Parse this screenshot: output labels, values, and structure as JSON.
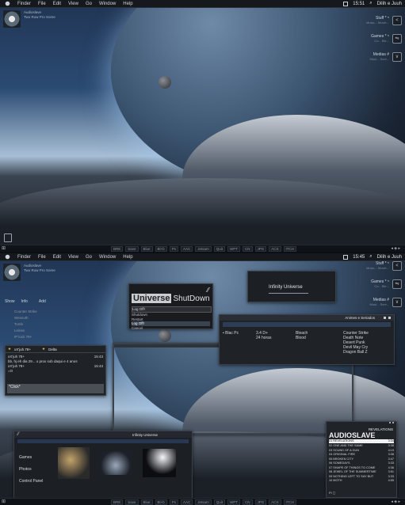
{
  "menubar": {
    "items": [
      "Finder",
      "File",
      "Edit",
      "View",
      "Go",
      "Window",
      "Help"
    ],
    "time_top": "15:51",
    "time_bottom": "15:45",
    "user": "Dilih e Juuh"
  },
  "itunes": {
    "title": "Audioslave",
    "subtitle": "Two Row Pro Some"
  },
  "dock_right": [
    {
      "label": "Stuff * ⁵",
      "sub": "Music... Movie...",
      "icon": "<"
    },
    {
      "label": "Games * ⁵",
      "sub": "Co... Ble...",
      "icon": "⇋"
    },
    {
      "label": "Medias #",
      "sub": "Musi... Scre...",
      "icon": "∨"
    }
  ],
  "taskbar": {
    "items": [
      "BRE",
      "Save",
      "Blue",
      "Bl+b",
      "Ps",
      "AAC",
      "Jetsam",
      "Quit",
      "WPT",
      "CN",
      "JPG",
      "ACS",
      "ITCH"
    ]
  },
  "shutdown": {
    "brand": "Universe",
    "title": "ShutDown",
    "selected": "Log Off!",
    "options": [
      "Shutdown",
      "Restart",
      "Log Off!",
      "Cancel"
    ]
  },
  "infinity_top": {
    "label": "Infinity Universe"
  },
  "left_links": {
    "tabs": [
      "Show",
      "Info",
      "Add"
    ],
    "items": [
      "Counter Strike",
      "Wesnoth",
      "Tomb",
      "Leinex",
      "IP lock 78+"
    ]
  },
  "chat": {
    "header_left": "xX'juh.78+",
    "header_right": "Delta",
    "lines": [
      {
        "who": "xX'juh 78+",
        "time": "15:43"
      },
      {
        "who": "bb, hj eh dia 29... o prox sob daqui e 4 anos",
        "time": ""
      },
      {
        "who": "xX'juh 78+",
        "time": "15:43"
      },
      {
        "who": "=O",
        "time": ""
      }
    ],
    "input": "*Click*"
  },
  "games": {
    "title": "Animes e Seriados",
    "left_label": "Blac Pc",
    "col1": [
      "3.4 D+",
      "24 horas"
    ],
    "col2": [
      "Bleach",
      "Blood"
    ],
    "col3": [
      "Counter Strike",
      "Death Note",
      "Desert Punk",
      "Devil May Cry",
      "Dragon Ball Z"
    ]
  },
  "explorer": {
    "title": "Infinity Universe",
    "nav": [
      "Games",
      "Photos",
      "Control Panel"
    ]
  },
  "music": {
    "brand": "AUDIOSLAVE",
    "album": "REVELATIONS",
    "now": "01 REVELATIONS",
    "now_time": "3:34",
    "tracks": [
      {
        "t": "02 ONE AND THE SAME",
        "d": "3:38"
      },
      {
        "t": "03 SOUND OF A GUN",
        "d": "4:19"
      },
      {
        "t": "04 ORIGINAL FIRE",
        "d": "3:38"
      },
      {
        "t": "05 BROKEN CITY",
        "d": "3:47"
      },
      {
        "t": "06 SOMEDAYS",
        "d": "3:33"
      },
      {
        "t": "07 SHAPE OF THINGS TO COME",
        "d": "4:36"
      },
      {
        "t": "08 JEWEL OF THE SUMMERTIME",
        "d": "3:51"
      },
      {
        "t": "09 NOTHING LEFT TO SAY BUT",
        "d": "3:33"
      },
      {
        "t": "10 MOTH",
        "d": "4:55"
      }
    ]
  }
}
